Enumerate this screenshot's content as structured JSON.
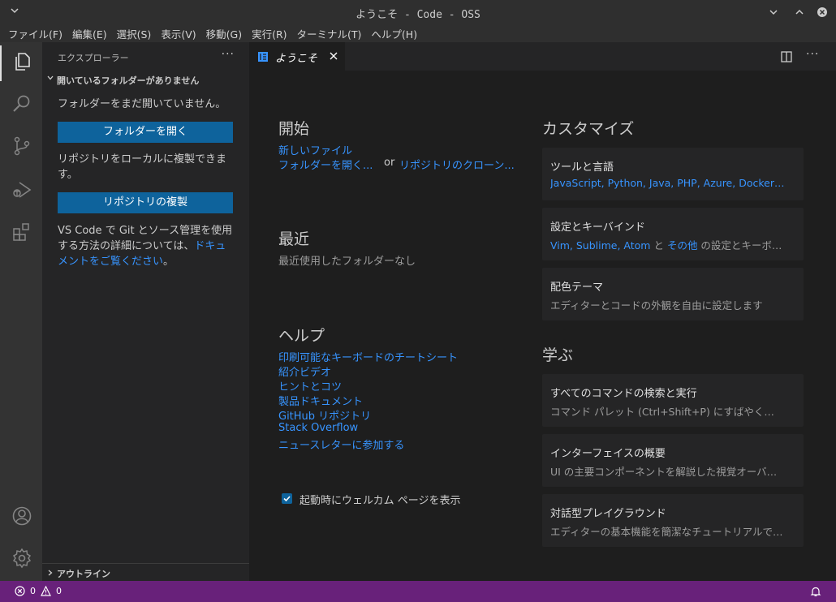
{
  "window": {
    "title": "ようこそ - Code - OSS"
  },
  "menu": [
    "ファイル(F)",
    "編集(E)",
    "選択(S)",
    "表示(V)",
    "移動(G)",
    "実行(R)",
    "ターミナル(T)",
    "ヘルプ(H)"
  ],
  "activity_icons": [
    "explorer-icon",
    "search-icon",
    "source-control-icon",
    "run-debug-icon",
    "extensions-icon",
    "account-icon",
    "settings-gear-icon"
  ],
  "sidebar": {
    "header": "エクスプローラー",
    "section": "開いているフォルダーがありません",
    "msg1": "フォルダーをまだ開いていません。",
    "open_folder_btn": "フォルダーを開く",
    "msg2": "リポジトリをローカルに複製できます。",
    "clone_btn": "リポジトリの複製",
    "msg3_prefix": "VS Code で Git とソース管理を使用する方法の詳細については、",
    "msg3_link": "ドキュメントをご覧ください",
    "msg3_suffix": "。",
    "outline": "アウトライン"
  },
  "tab": {
    "label": "ようこそ"
  },
  "welcome": {
    "start_title": "開始",
    "new_file": "新しいファイル",
    "open_folder": "フォルダーを開く...",
    "or": "or",
    "clone_repo": "リポジトリのクローン...",
    "recent_title": "最近",
    "recent_empty": "最近使用したフォルダーなし",
    "help_title": "ヘルプ",
    "help_links": [
      "印刷可能なキーボードのチートシート",
      "紹介ビデオ",
      "ヒントとコツ",
      "製品ドキュメント",
      "GitHub リポジトリ",
      "Stack Overflow",
      "ニュースレターに参加する"
    ],
    "show_on_startup": "起動時にウェルカム ページを表示",
    "customize_title": "カスタマイズ",
    "learn_title": "学ぶ",
    "cards_customize": [
      {
        "title": "ツールと言語",
        "desc_links": "JavaScript, Python, Java, PHP, Azure, Docker…"
      },
      {
        "title": "設定とキーバインド",
        "desc_links": "Vim, Sublime, Atom",
        "desc_and": " と ",
        "desc_more": "その他",
        "desc_rest": " の設定とキーボ…"
      },
      {
        "title": "配色テーマ",
        "desc": "エディターとコードの外観を自由に設定します"
      }
    ],
    "cards_learn": [
      {
        "title": "すべてのコマンドの検索と実行",
        "desc": "コマンド パレット (Ctrl+Shift+P) にすばやく…"
      },
      {
        "title": "インターフェイスの概要",
        "desc": "UI の主要コンポーネントを解説した視覚オーバ…"
      },
      {
        "title": "対話型プレイグラウンド",
        "desc": "エディターの基本機能を簡潔なチュートリアルで…"
      }
    ]
  },
  "status": {
    "errors": "0",
    "warnings": "0"
  },
  "colors": {
    "accent": "#0e639c",
    "link": "#3794ff",
    "statusbar": "#68217a"
  }
}
